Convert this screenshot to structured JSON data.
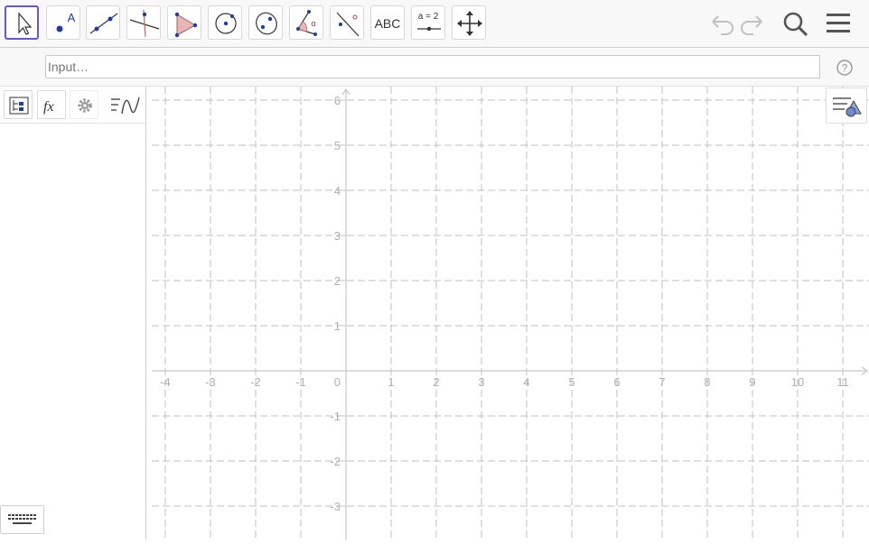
{
  "toolbar": {
    "tools": [
      {
        "name": "move-tool",
        "label": ""
      },
      {
        "name": "point-tool",
        "label": "A"
      },
      {
        "name": "line-tool",
        "label": ""
      },
      {
        "name": "perpendicular-tool",
        "label": ""
      },
      {
        "name": "polygon-tool",
        "label": ""
      },
      {
        "name": "circle-tool",
        "label": ""
      },
      {
        "name": "conic-tool",
        "label": ""
      },
      {
        "name": "angle-tool",
        "label": "α"
      },
      {
        "name": "reflect-tool",
        "label": ""
      },
      {
        "name": "text-tool",
        "label": "ABC"
      },
      {
        "name": "slider-tool",
        "label": "a = 2"
      },
      {
        "name": "move-graphics-tool",
        "label": ""
      }
    ]
  },
  "input": {
    "placeholder": "Input…"
  },
  "graphics": {
    "x_ticks": [
      "-4",
      "-3",
      "-2",
      "-1",
      "0",
      "1",
      "2",
      "3",
      "4",
      "5",
      "6",
      "7",
      "8",
      "9",
      "10",
      "11"
    ],
    "y_ticks_pos": [
      "1",
      "2",
      "3",
      "4",
      "5",
      "6"
    ],
    "y_ticks_neg": [
      "-1",
      "-2",
      "-3"
    ]
  },
  "colors": {
    "accent": "#6557d2",
    "grid": "#c0c0c0",
    "axis": "#c8c8c8"
  }
}
